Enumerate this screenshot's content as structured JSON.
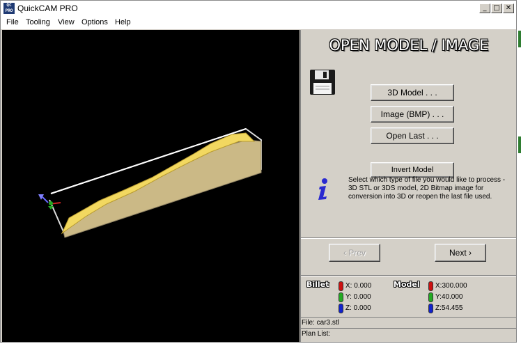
{
  "window": {
    "title": "QuickCAM PRO",
    "icon_text_top": "QC",
    "icon_text_bottom": "PRO"
  },
  "titlebar_buttons": {
    "minimize": "_",
    "maximize": "□",
    "close": "✕"
  },
  "menu": [
    "File",
    "Tooling",
    "View",
    "Options",
    "Help"
  ],
  "panel": {
    "title": "OPEN MODEL / IMAGE",
    "icon": "floppy-disk-icon",
    "buttons": {
      "model3d": "3D Model . . .",
      "image_bmp": "Image (BMP) . . .",
      "open_last": "Open Last . . .",
      "invert": "Invert Model"
    },
    "info_icon": "info-icon",
    "info_text": "Select which type of file you would like to process - 3D STL or 3DS model, 2D Bitmap image for conversion into 3D or reopen the last file used.",
    "nav": {
      "prev": "‹ Prev",
      "next": "Next ›",
      "prev_enabled": false
    }
  },
  "coords": {
    "billet_label": "Billet",
    "model_label": "Model",
    "billet": {
      "x": "X: 0.000",
      "y": "Y: 0.000",
      "z": "Z: 0.000"
    },
    "model": {
      "x": "X:300.000",
      "y": "Y:40.000",
      "z": "Z:54.455"
    },
    "colors": {
      "x": "#cc1111",
      "y": "#22aa22",
      "z": "#1122cc"
    }
  },
  "status": {
    "file": "File: car3.stl",
    "plan": "Plan List:"
  },
  "colors": {
    "model_top": "#f2d860",
    "model_side": "#cbb986",
    "viewport_bg": "#000000"
  }
}
